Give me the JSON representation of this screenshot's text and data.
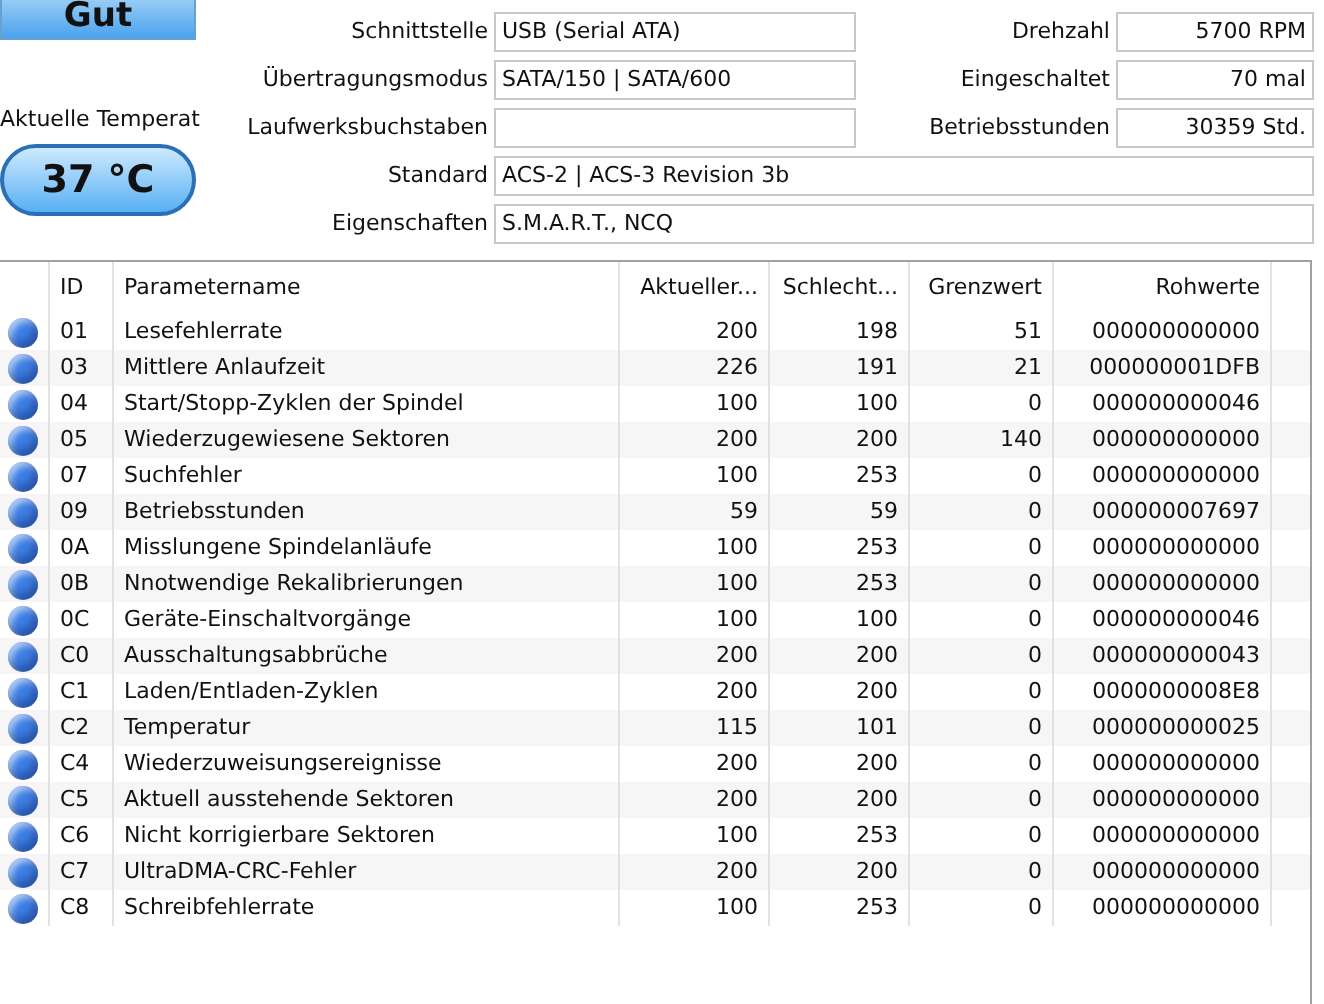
{
  "health": {
    "status": "Gut"
  },
  "temperature": {
    "label": "Aktuelle Temperat",
    "value": "37 °C"
  },
  "info_rows": [
    {
      "label": "Schnittstelle",
      "value": "USB (Serial ATA)",
      "side_label": "Drehzahl",
      "side_value": "5700 RPM"
    },
    {
      "label": "Übertragungsmodus",
      "value": "SATA/150 | SATA/600",
      "side_label": "Eingeschaltet",
      "side_value": "70 mal"
    },
    {
      "label": "Laufwerksbuchstaben",
      "value": "",
      "side_label": "Betriebsstunden",
      "side_value": "30359 Std."
    },
    {
      "label": "Standard",
      "value": "ACS-2 | ACS-3 Revision 3b"
    },
    {
      "label": "Eigenschaften",
      "value": "S.M.A.R.T., NCQ"
    }
  ],
  "table": {
    "columns": [
      "ID",
      "Parametername",
      "Aktueller...",
      "Schlecht...",
      "Grenzwert",
      "Rohwerte"
    ],
    "rows": [
      {
        "color": "#3d7fe6",
        "cells": [
          "01",
          "Lesefehlerrate",
          "200",
          "198",
          "51",
          "000000000000"
        ]
      },
      {
        "color": "#3d7fe6",
        "cells": [
          "03",
          "Mittlere Anlaufzeit",
          "226",
          "191",
          "21",
          "000000001DFB"
        ]
      },
      {
        "color": "#3d7fe6",
        "cells": [
          "04",
          "Start/Stopp-Zyklen der Spindel",
          "100",
          "100",
          "0",
          "000000000046"
        ]
      },
      {
        "color": "#3d7fe6",
        "cells": [
          "05",
          "Wiederzugewiesene Sektoren",
          "200",
          "200",
          "140",
          "000000000000"
        ]
      },
      {
        "color": "#3d7fe6",
        "cells": [
          "07",
          "Suchfehler",
          "100",
          "253",
          "0",
          "000000000000"
        ]
      },
      {
        "color": "#3d7fe6",
        "cells": [
          "09",
          "Betriebsstunden",
          "59",
          "59",
          "0",
          "000000007697"
        ]
      },
      {
        "color": "#3d7fe6",
        "cells": [
          "0A",
          "Misslungene Spindelanläufe",
          "100",
          "253",
          "0",
          "000000000000"
        ]
      },
      {
        "color": "#3d7fe6",
        "cells": [
          "0B",
          "Nnotwendige Rekalibrierungen",
          "100",
          "253",
          "0",
          "000000000000"
        ]
      },
      {
        "color": "#3d7fe6",
        "cells": [
          "0C",
          "Geräte-Einschaltvorgänge",
          "100",
          "100",
          "0",
          "000000000046"
        ]
      },
      {
        "color": "#3d7fe6",
        "cells": [
          "C0",
          "Ausschaltungsabbrüche",
          "200",
          "200",
          "0",
          "000000000043"
        ]
      },
      {
        "color": "#3d7fe6",
        "cells": [
          "C1",
          "Laden/Entladen-Zyklen",
          "200",
          "200",
          "0",
          "0000000008E8"
        ]
      },
      {
        "color": "#3d7fe6",
        "cells": [
          "C2",
          "Temperatur",
          "115",
          "101",
          "0",
          "000000000025"
        ]
      },
      {
        "color": "#3d7fe6",
        "cells": [
          "C4",
          "Wiederzuweisungsereignisse",
          "200",
          "200",
          "0",
          "000000000000"
        ]
      },
      {
        "color": "#3d7fe6",
        "cells": [
          "C5",
          "Aktuell ausstehende Sektoren",
          "200",
          "200",
          "0",
          "000000000000"
        ]
      },
      {
        "color": "#3d7fe6",
        "cells": [
          "C6",
          "Nicht korrigierbare Sektoren",
          "100",
          "253",
          "0",
          "000000000000"
        ]
      },
      {
        "color": "#3d7fe6",
        "cells": [
          "C7",
          "UltraDMA-CRC-Fehler",
          "200",
          "200",
          "0",
          "000000000000"
        ]
      },
      {
        "color": "#3d7fe6",
        "cells": [
          "C8",
          "Schreibfehlerrate",
          "100",
          "253",
          "0",
          "000000000000"
        ]
      }
    ]
  }
}
